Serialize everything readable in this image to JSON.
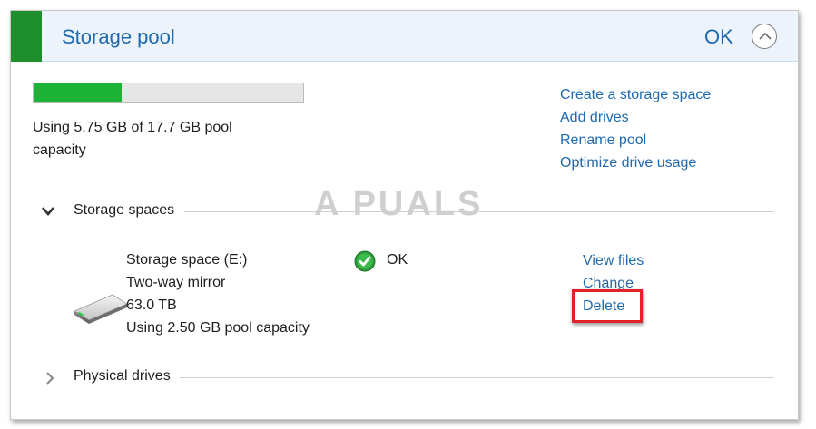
{
  "header": {
    "title": "Storage pool",
    "status": "OK",
    "collapse_icon": "chevron-up-icon",
    "accent_color": "#1f8e2c"
  },
  "pool": {
    "usage_fraction": 0.325,
    "usage_text": "Using 5.75 GB of 17.7 GB pool capacity",
    "bar_color": "#1db336"
  },
  "pool_actions": [
    "Create a storage space",
    "Add drives",
    "Rename pool",
    "Optimize drive usage"
  ],
  "storage_spaces": {
    "section_label": "Storage spaces",
    "expanded": true,
    "space": {
      "name": "Storage space (E:)",
      "resiliency": "Two-way mirror",
      "size": "63.0 TB",
      "usage": "Using 2.50 GB pool capacity",
      "status": "OK",
      "status_icon": "check-circle-icon",
      "drive_icon": "hard-drive-icon"
    },
    "actions": [
      "View files",
      "Change",
      "Delete"
    ],
    "highlighted_action": "Delete",
    "highlight_color": "#e0232a"
  },
  "physical_drives": {
    "section_label": "Physical drives",
    "expanded": false
  },
  "watermark": {
    "text": "A  PUALS"
  }
}
